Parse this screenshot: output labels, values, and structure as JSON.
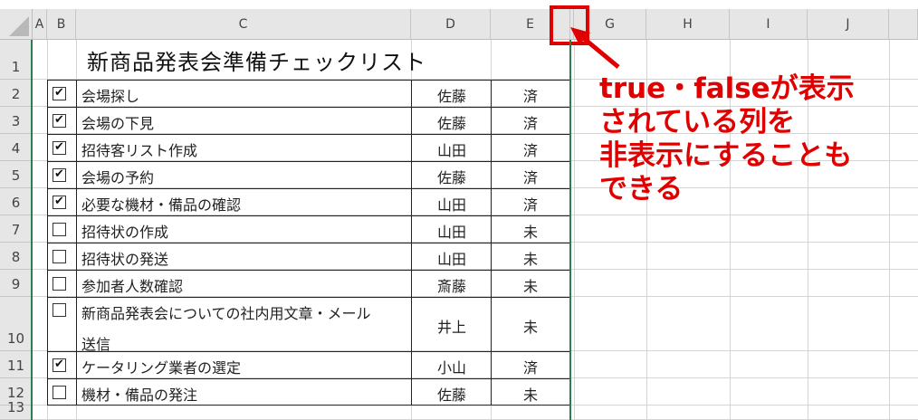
{
  "columns": [
    "A",
    "B",
    "C",
    "D",
    "E",
    "G",
    "H",
    "I",
    "J"
  ],
  "rows": [
    "1",
    "2",
    "3",
    "4",
    "5",
    "6",
    "7",
    "8",
    "9",
    "10",
    "11",
    "12",
    "13"
  ],
  "title": "新商品発表会準備チェックリスト",
  "tasks": [
    {
      "checked": true,
      "task": "会場探し",
      "task2": "",
      "person": "佐藤",
      "status": "済"
    },
    {
      "checked": true,
      "task": "会場の下見",
      "task2": "",
      "person": "佐藤",
      "status": "済"
    },
    {
      "checked": true,
      "task": "招待客リスト作成",
      "task2": "",
      "person": "山田",
      "status": "済"
    },
    {
      "checked": true,
      "task": "会場の予約",
      "task2": "",
      "person": "佐藤",
      "status": "済"
    },
    {
      "checked": true,
      "task": "必要な機材・備品の確認",
      "task2": "",
      "person": "山田",
      "status": "済"
    },
    {
      "checked": false,
      "task": "招待状の作成",
      "task2": "",
      "person": "山田",
      "status": "未"
    },
    {
      "checked": false,
      "task": "招待状の発送",
      "task2": "",
      "person": "山田",
      "status": "未"
    },
    {
      "checked": false,
      "task": "参加者人数確認",
      "task2": "",
      "person": "斎藤",
      "status": "未"
    },
    {
      "checked": false,
      "task": "新商品発表会についての社内用文章・メール",
      "task2": "送信",
      "person": "井上",
      "status": "未"
    },
    {
      "checked": true,
      "task": "ケータリング業者の選定",
      "task2": "",
      "person": "小山",
      "status": "済"
    },
    {
      "checked": false,
      "task": "機材・備品の発注",
      "task2": "",
      "person": "佐藤",
      "status": "未"
    }
  ],
  "callout": [
    "true・falseが表示",
    "されている列を",
    "非表示にすることも",
    "できる"
  ],
  "colors": {
    "accent": "#e00000",
    "selection_border": "#2e7d4f"
  },
  "icons": {
    "check": "check-icon",
    "arrow": "arrow-icon"
  }
}
